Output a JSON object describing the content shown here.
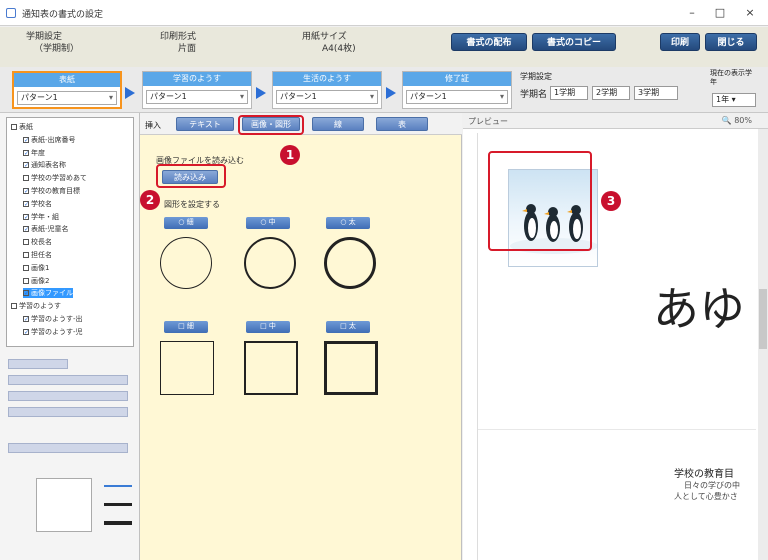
{
  "window": {
    "title": "通知表の書式の設定",
    "minimize": "–",
    "maximize": "□",
    "close": "×"
  },
  "info": {
    "term_label": "学期設定",
    "term_value": "（学期制）",
    "print_label": "印刷形式",
    "print_value": "片面",
    "paper_label": "用紙サイズ",
    "paper_value": "A4(4枚)",
    "buttons": [
      "書式の配布",
      "書式のコピー",
      "印刷",
      "閉じる"
    ],
    "term_setting_label": "学期設定",
    "term_name_label": "学期名",
    "terms": [
      "1学期",
      "2学期",
      "3学期"
    ],
    "grade_label": "現在の表示学年",
    "grade_value": "1年"
  },
  "patterns": [
    {
      "header": "表紙",
      "value": "パターン1"
    },
    {
      "header": "学習のようす",
      "value": "パターン1"
    },
    {
      "header": "生活のようす",
      "value": "パターン1"
    },
    {
      "header": "修了証",
      "value": "パターン1"
    }
  ],
  "tree": {
    "nodes": [
      {
        "label": "表紙",
        "check": false
      },
      {
        "label": "表紙-出席番号",
        "check": true
      },
      {
        "label": "年度",
        "check": true
      },
      {
        "label": "通知表名称",
        "check": true
      },
      {
        "label": "学校の学習めあて",
        "check": false
      },
      {
        "label": "学校の教育目標",
        "check": true
      },
      {
        "label": "学校名",
        "check": true
      },
      {
        "label": "学年・組",
        "check": true
      },
      {
        "label": "表紙-児童名",
        "check": true
      },
      {
        "label": "校長名",
        "check": false
      },
      {
        "label": "担任名",
        "check": false
      },
      {
        "label": "画像1",
        "check": false
      },
      {
        "label": "画像2",
        "check": false
      },
      {
        "label": "画像ファイル",
        "check": true
      },
      {
        "label": "学習のようす",
        "check": false
      },
      {
        "label": "学習のようす-出",
        "check": true
      },
      {
        "label": "学習のようす-児",
        "check": true
      }
    ]
  },
  "editor": {
    "insert_label": "挿入",
    "toolbar_buttons": [
      "テキスト",
      "画像・図形",
      "線",
      "表"
    ],
    "image_file_text": "画像ファイルを読み込む",
    "load_button": "読み込み",
    "shape_text": "図形を設定する",
    "shape_labels": [
      "○ 細",
      "○ 中",
      "○ 太",
      "□ 細",
      "□ 中",
      "□ 太"
    ]
  },
  "preview": {
    "label": "プレビュー",
    "zoom": "80%",
    "big_text": "あゆ",
    "school_text": "学校の教育目",
    "line1": "日々の学びの中",
    "line2": "人として心豊かさ"
  },
  "callouts": {
    "one": "1",
    "two": "2",
    "three": "3"
  }
}
